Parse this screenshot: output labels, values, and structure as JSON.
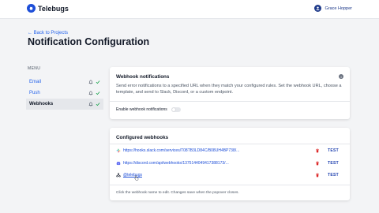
{
  "app": {
    "name": "Telebugs"
  },
  "user": {
    "name": "Grace Hopper"
  },
  "nav": {
    "back_label": "← Back to Projects"
  },
  "page": {
    "title": "Notification Configuration"
  },
  "menu": {
    "heading": "MENU",
    "items": [
      {
        "label": "Email",
        "active": false
      },
      {
        "label": "Push",
        "active": false
      },
      {
        "label": "Webhooks",
        "active": true
      }
    ]
  },
  "webhook_card": {
    "title": "Webhook notifications",
    "description": "Send error notifications to a specified URL when they match your configured rules. Set the webhook URL, choose a template, and send to Slack, Discord, or a custom endpoint.",
    "enable_label": "Enable webhook notifications",
    "enabled": false
  },
  "configured": {
    "title": "Configured webhooks",
    "rows": [
      {
        "icon": "slack-icon",
        "url": "https://hooks.slack.com/services/T08TB3LD84C/B08UH4BP738/...",
        "action": "TEST"
      },
      {
        "icon": "discord-icon",
        "url": "https://discord.com/api/webhooks/1375144049417388173/...",
        "action": "TEST"
      },
      {
        "icon": "webhook-icon",
        "url": "@telebugs",
        "action": "TEST"
      }
    ],
    "footer_note": "Click the webhook name to edit. Changes save when the popover closes."
  },
  "colors": {
    "accent": "#2563eb",
    "brand": "#1d4ed8",
    "danger": "#dc2626",
    "success": "#16a34a"
  }
}
